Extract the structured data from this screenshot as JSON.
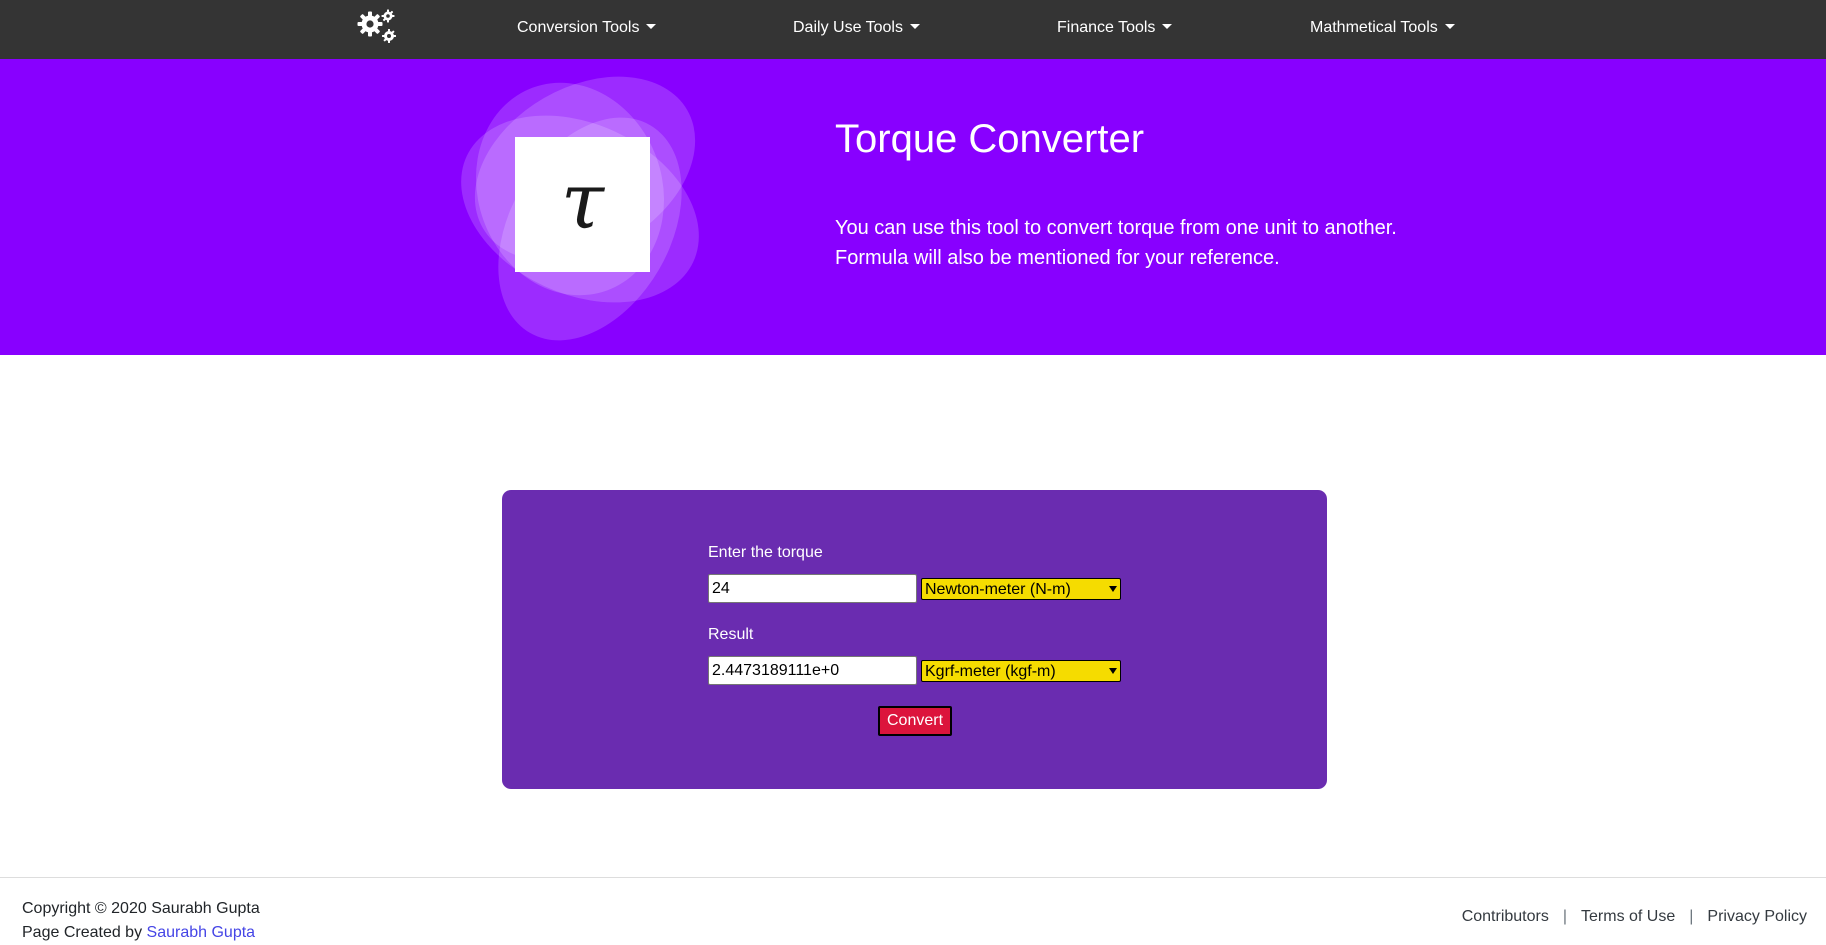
{
  "navbar": {
    "logo_icon": "gears-icon",
    "items": [
      {
        "label": "Conversion Tools"
      },
      {
        "label": "Daily Use Tools"
      },
      {
        "label": "Finance Tools"
      },
      {
        "label": "Mathmetical Tools"
      }
    ]
  },
  "hero": {
    "icon_glyph": "τ",
    "title": "Torque Converter",
    "description_line1": "You can use this tool to convert torque from one unit to another.",
    "description_line2": "Formula will also be mentioned for your reference.",
    "background_color": "#8800ff"
  },
  "converter": {
    "input_label": "Enter the torque",
    "input_value": "24",
    "input_unit": "Newton-meter (N-m)",
    "result_label": "Result",
    "result_value": "2.4473189111e+0",
    "result_unit": "Kgrf-meter (kgf-m)",
    "convert_label": "Convert",
    "card_color": "#6a2cb0",
    "select_color": "#f5dc00",
    "button_color": "#dc143c"
  },
  "footer": {
    "copyright": "Copyright © 2020 Saurabh Gupta",
    "created_by_prefix": "Page Created by",
    "created_by_name": "Saurabh Gupta",
    "links": [
      {
        "label": "Contributors"
      },
      {
        "label": "Terms of Use"
      },
      {
        "label": "Privacy Policy"
      }
    ],
    "separator": "|"
  }
}
